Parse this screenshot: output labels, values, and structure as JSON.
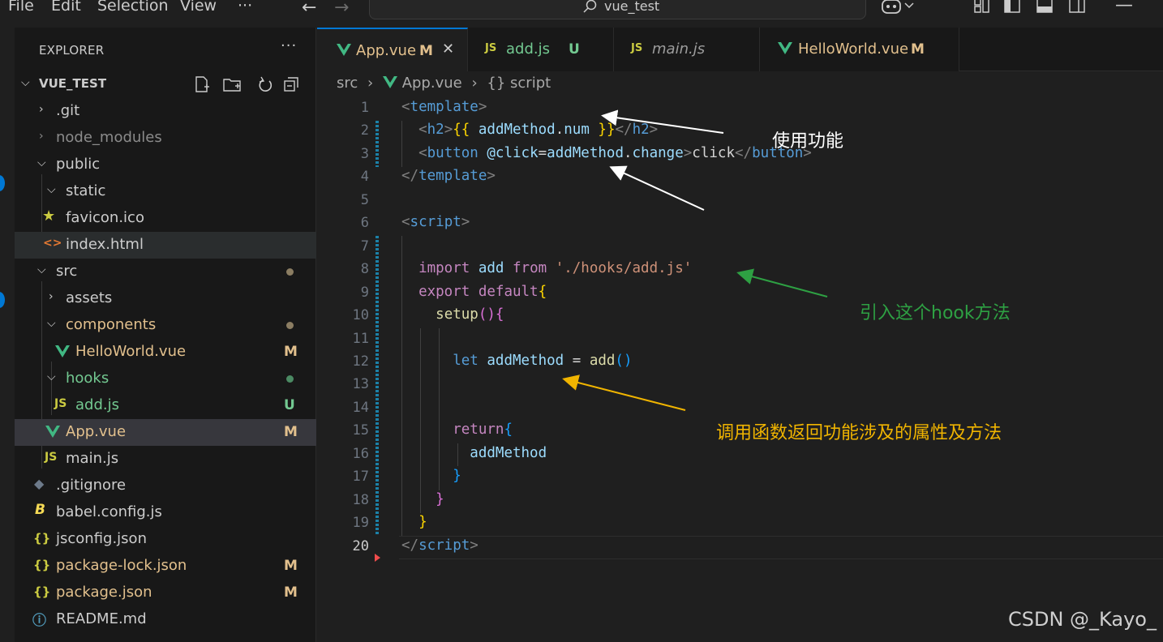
{
  "menu": [
    "File",
    "Edit",
    "Selection",
    "View",
    "···"
  ],
  "command_center": {
    "text": "vue_test"
  },
  "explorer": {
    "title": "EXPLORER",
    "more": "···",
    "root": "VUE_TEST",
    "items": [
      {
        "label": "> .git",
        "name": ".git"
      },
      {
        "label": "node_modules"
      },
      {
        "label": "public"
      },
      {
        "label": "static"
      },
      {
        "label": "favicon.ico"
      },
      {
        "label": "index.html",
        "icon": "<>"
      },
      {
        "label": "src"
      },
      {
        "label": "assets"
      },
      {
        "label": "components"
      },
      {
        "label": "HelloWorld.vue",
        "status": "M"
      },
      {
        "label": "hooks"
      },
      {
        "label": "add.js",
        "icon": "JS",
        "status": "U"
      },
      {
        "label": "App.vue",
        "status": "M"
      },
      {
        "label": "main.js",
        "icon": "JS"
      },
      {
        "label": ".gitignore"
      },
      {
        "label": "babel.config.js",
        "icon": "B"
      },
      {
        "label": "jsconfig.json",
        "icon": "{}"
      },
      {
        "label": "package-lock.json",
        "icon": "{}",
        "status": "M"
      },
      {
        "label": "package.json",
        "icon": "{}",
        "status": "M"
      },
      {
        "label": "README.md"
      }
    ]
  },
  "tabs": [
    {
      "label": "App.vue",
      "status": "M",
      "close": "✕"
    },
    {
      "label": "add.js",
      "icon": "JS",
      "status": "U"
    },
    {
      "label": "main.js",
      "icon": "JS"
    },
    {
      "label": "HelloWorld.vue",
      "status": "M"
    }
  ],
  "breadcrumb": {
    "src": "src",
    "sep": "›",
    "file": "App.vue",
    "symbol_icon": "{}",
    "symbol": "script"
  },
  "editor": {
    "line_numbers": [
      "1",
      "2",
      "3",
      "4",
      "5",
      "6",
      "7",
      "8",
      "9",
      "10",
      "11",
      "12",
      "13",
      "14",
      "15",
      "16",
      "17",
      "18",
      "19",
      "20"
    ],
    "lines": [
      [
        [
          "tg",
          "<"
        ],
        [
          "tn",
          "template"
        ],
        [
          "tg",
          ">"
        ]
      ],
      [
        [
          "wh",
          "  "
        ],
        [
          "tg",
          "<"
        ],
        [
          "tn",
          "h2"
        ],
        [
          "tg",
          ">"
        ],
        [
          "pu",
          "{{"
        ],
        [
          "wh",
          " "
        ],
        [
          "vr",
          "addMethod"
        ],
        [
          "wh",
          "."
        ],
        [
          "vr",
          "num"
        ],
        [
          "wh",
          " "
        ],
        [
          "pu",
          "}}"
        ],
        [
          "tg",
          "</"
        ],
        [
          "tn",
          "h2"
        ],
        [
          "tg",
          ">"
        ]
      ],
      [
        [
          "wh",
          "  "
        ],
        [
          "tg",
          "<"
        ],
        [
          "tn",
          "button"
        ],
        [
          "wh",
          " "
        ],
        [
          "vr",
          "@click"
        ],
        [
          "wh",
          "="
        ],
        [
          "vr",
          "addMethod"
        ],
        [
          "wh",
          "."
        ],
        [
          "vr",
          "change"
        ],
        [
          "tg",
          ">"
        ],
        [
          "wh",
          "click"
        ],
        [
          "tg",
          "</"
        ],
        [
          "tn",
          "button"
        ],
        [
          "tg",
          ">"
        ]
      ],
      [
        [
          "tg",
          "</"
        ],
        [
          "tn",
          "template"
        ],
        [
          "tg",
          ">"
        ]
      ],
      [],
      [
        [
          "tg",
          "<"
        ],
        [
          "tn",
          "script"
        ],
        [
          "tg",
          ">"
        ]
      ],
      [],
      [
        [
          "wh",
          "  "
        ],
        [
          "kw",
          "import"
        ],
        [
          "wh",
          " "
        ],
        [
          "vr",
          "add"
        ],
        [
          "wh",
          " "
        ],
        [
          "kw",
          "from"
        ],
        [
          "wh",
          " "
        ],
        [
          "st",
          "'./hooks/add.js'"
        ]
      ],
      [
        [
          "wh",
          "  "
        ],
        [
          "kw",
          "export"
        ],
        [
          "wh",
          " "
        ],
        [
          "kw",
          "default"
        ],
        [
          "pu",
          "{"
        ]
      ],
      [
        [
          "wh",
          "    "
        ],
        [
          "fn",
          "setup"
        ],
        [
          "pk",
          "(){"
        ]
      ],
      [],
      [
        [
          "wh",
          "      "
        ],
        [
          "dk",
          "let"
        ],
        [
          "wh",
          " "
        ],
        [
          "vr",
          "addMethod"
        ],
        [
          "wh",
          " = "
        ],
        [
          "fn",
          "add"
        ],
        [
          "bl",
          "()"
        ]
      ],
      [],
      [],
      [
        [
          "wh",
          "      "
        ],
        [
          "kw",
          "return"
        ],
        [
          "bl",
          "{"
        ]
      ],
      [
        [
          "wh",
          "        "
        ],
        [
          "vr",
          "addMethod"
        ]
      ],
      [
        [
          "wh",
          "      "
        ],
        [
          "bl",
          "}"
        ]
      ],
      [
        [
          "wh",
          "    "
        ],
        [
          "pk",
          "}"
        ]
      ],
      [
        [
          "wh",
          "  "
        ],
        [
          "pu",
          "}"
        ]
      ],
      [
        [
          "tg",
          "</"
        ],
        [
          "tn",
          "script"
        ],
        [
          "tg",
          ">"
        ]
      ]
    ]
  },
  "annotations": {
    "use": "使用功能",
    "import": "引入这个hook方法",
    "return": "调用函数返回功能涉及的属性及方法"
  },
  "colors": {
    "vue_green": "#41b883",
    "js_yellow": "#cbcb41",
    "modified": "#e2c08d",
    "untracked": "#73c991",
    "accent": "#0078d4",
    "arrow_white": "#ffffff",
    "arrow_green": "#2ea043",
    "arrow_orange": "#f0b400"
  },
  "watermark": "CSDN @_Kayo_"
}
